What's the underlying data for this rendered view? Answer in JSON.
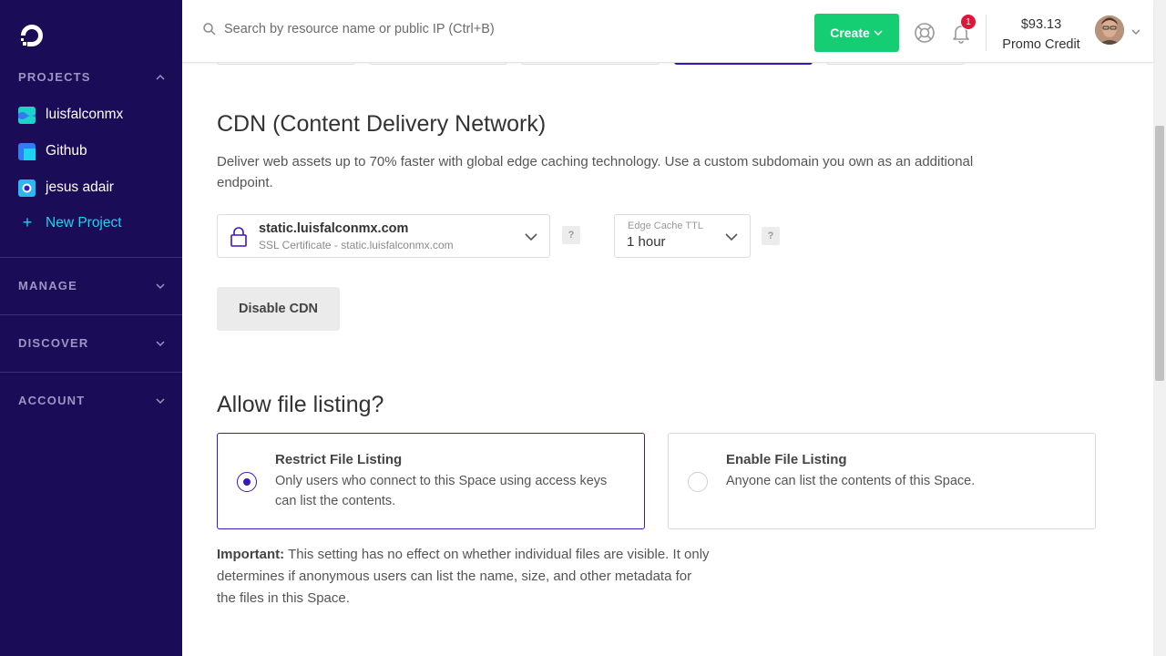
{
  "sidebar": {
    "projects_header": "PROJECTS",
    "projects": [
      {
        "label": "luisfalconmx",
        "color": "#1bd3c9"
      },
      {
        "label": "Github",
        "color": "#2f7cf6"
      },
      {
        "label": "jesus adair",
        "color": "#29b8f0"
      }
    ],
    "new_project_label": "New Project",
    "sections": [
      "MANAGE",
      "DISCOVER",
      "ACCOUNT"
    ]
  },
  "header": {
    "search_placeholder": "Search by resource name or public IP (Ctrl+B)",
    "create_label": "Create",
    "notification_count": "1",
    "credit_amount": "$93.13",
    "credit_label": "Promo Credit"
  },
  "cdn": {
    "title": "CDN (Content Delivery Network)",
    "description": "Deliver web assets up to 70% faster with global edge caching technology. Use a custom subdomain you own as an additional endpoint.",
    "endpoint": "static.luisfalconmx.com",
    "certificate": "SSL Certificate - static.luisfalconmx.com",
    "ttl_label": "Edge Cache TTL",
    "ttl_value": "1 hour",
    "help_glyph": "?",
    "disable_label": "Disable CDN"
  },
  "file_listing": {
    "title": "Allow file listing?",
    "options": [
      {
        "title": "Restrict File Listing",
        "text": "Only users who connect to this Space using access keys can list the contents.",
        "selected": true
      },
      {
        "title": "Enable File Listing",
        "text": "Anyone can list the contents of this Space.",
        "selected": false
      }
    ],
    "important_label": "Important:",
    "important_text": " This setting has no effect on whether individual files are visible. It only determines if anonymous users can list the name, size, and other metadata for the files in this Space."
  },
  "colors": {
    "sidebar_bg": "#1b0c57",
    "accent": "#3d14c2",
    "create_green": "#15cd72",
    "new_project": "#1bd3f2"
  }
}
